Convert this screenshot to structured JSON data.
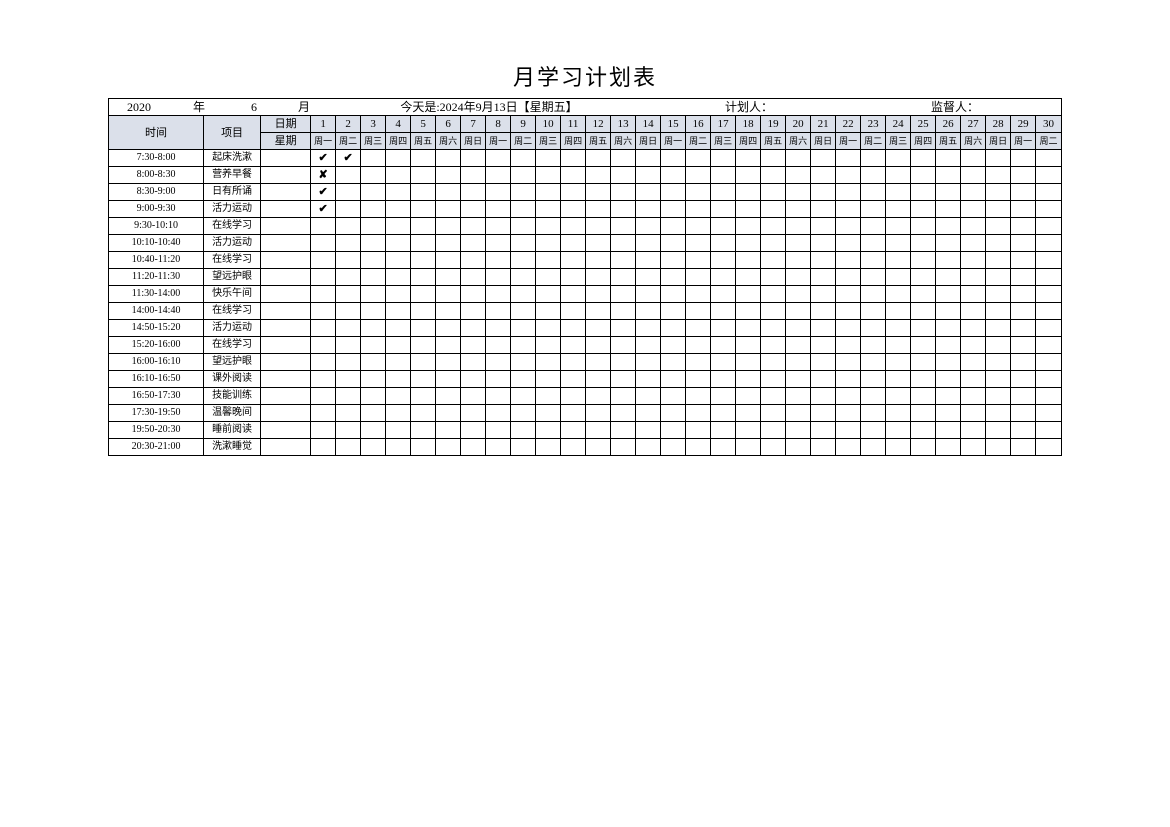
{
  "title": "月学习计划表",
  "header": {
    "year": "2020",
    "year_label": "年",
    "month": "6",
    "month_label": "月",
    "today_text": "今天是:2024年9月13日【星期五】",
    "planner_label": "计划人：",
    "supervisor_label": "监督人："
  },
  "row_header": {
    "time_label": "时间",
    "project_label": "项目",
    "date_label": "日期",
    "weekday_label": "星期"
  },
  "days": [
    "1",
    "2",
    "3",
    "4",
    "5",
    "6",
    "7",
    "8",
    "9",
    "10",
    "11",
    "12",
    "13",
    "14",
    "15",
    "16",
    "17",
    "18",
    "19",
    "20",
    "21",
    "22",
    "23",
    "24",
    "25",
    "26",
    "27",
    "28",
    "29",
    "30"
  ],
  "weekdays": [
    "周一",
    "周二",
    "周三",
    "周四",
    "周五",
    "周六",
    "周日",
    "周一",
    "周二",
    "周三",
    "周四",
    "周五",
    "周六",
    "周日",
    "周一",
    "周二",
    "周三",
    "周四",
    "周五",
    "周六",
    "周日",
    "周一",
    "周二",
    "周三",
    "周四",
    "周五",
    "周六",
    "周日",
    "周一",
    "周二"
  ],
  "rows": [
    {
      "time": "7:30-8:00",
      "proj": "起床洗漱",
      "marks": {
        "0": "✔",
        "1": "✔"
      }
    },
    {
      "time": "8:00-8:30",
      "proj": "营养早餐",
      "marks": {
        "0": "✘"
      }
    },
    {
      "time": "8:30-9:00",
      "proj": "日有所诵",
      "marks": {
        "0": "✔"
      }
    },
    {
      "time": "9:00-9:30",
      "proj": "活力运动",
      "marks": {
        "0": "✔"
      }
    },
    {
      "time": "9:30-10:10",
      "proj": "在线学习",
      "marks": {}
    },
    {
      "time": "10:10-10:40",
      "proj": "活力运动",
      "marks": {}
    },
    {
      "time": "10:40-11:20",
      "proj": "在线学习",
      "marks": {}
    },
    {
      "time": "11:20-11:30",
      "proj": "望远护眼",
      "marks": {}
    },
    {
      "time": "11:30-14:00",
      "proj": "快乐午间",
      "marks": {}
    },
    {
      "time": "14:00-14:40",
      "proj": "在线学习",
      "marks": {}
    },
    {
      "time": "14:50-15:20",
      "proj": "活力运动",
      "marks": {}
    },
    {
      "time": "15:20-16:00",
      "proj": "在线学习",
      "marks": {}
    },
    {
      "time": "16:00-16:10",
      "proj": "望远护眼",
      "marks": {}
    },
    {
      "time": "16:10-16:50",
      "proj": "课外阅读",
      "marks": {}
    },
    {
      "time": "16:50-17:30",
      "proj": "技能训练",
      "marks": {}
    },
    {
      "time": "17:30-19:50",
      "proj": "温馨晚间",
      "marks": {}
    },
    {
      "time": "19:50-20:30",
      "proj": "睡前阅读",
      "marks": {}
    },
    {
      "time": "20:30-21:00",
      "proj": "洗漱睡觉",
      "marks": {}
    }
  ]
}
